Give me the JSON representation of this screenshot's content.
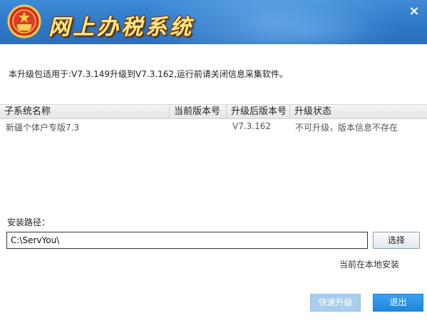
{
  "window": {
    "title": "网上办税系统",
    "close_icon": "close-icon",
    "close_glyph": "×",
    "header_colors": {
      "top": "#3f8ad6",
      "bottom": "#2a6fbd",
      "title": "#ffe98a"
    }
  },
  "notice": "本升级包适用于:V7.3.149升级到V7.3.162,运行前请关闭信息采集软件。",
  "table": {
    "headers": [
      "子系统名称",
      "当前版本号",
      "升级后版本号",
      "升级状态"
    ],
    "rows": [
      {
        "name": "新疆个体户专版7.3",
        "current": "",
        "upgraded": "V7.3.162",
        "status": "不可升级，版本信息不存在"
      }
    ]
  },
  "install": {
    "label": "安装路径：",
    "path_value": "C:\\ServYou\\",
    "browse_label": "选择",
    "status": "当前在本地安装"
  },
  "footer": {
    "quick_upgrade_label": "快速升级",
    "exit_label": "退出",
    "accent": "#1e87dc",
    "disabled": "#a9cdec"
  }
}
